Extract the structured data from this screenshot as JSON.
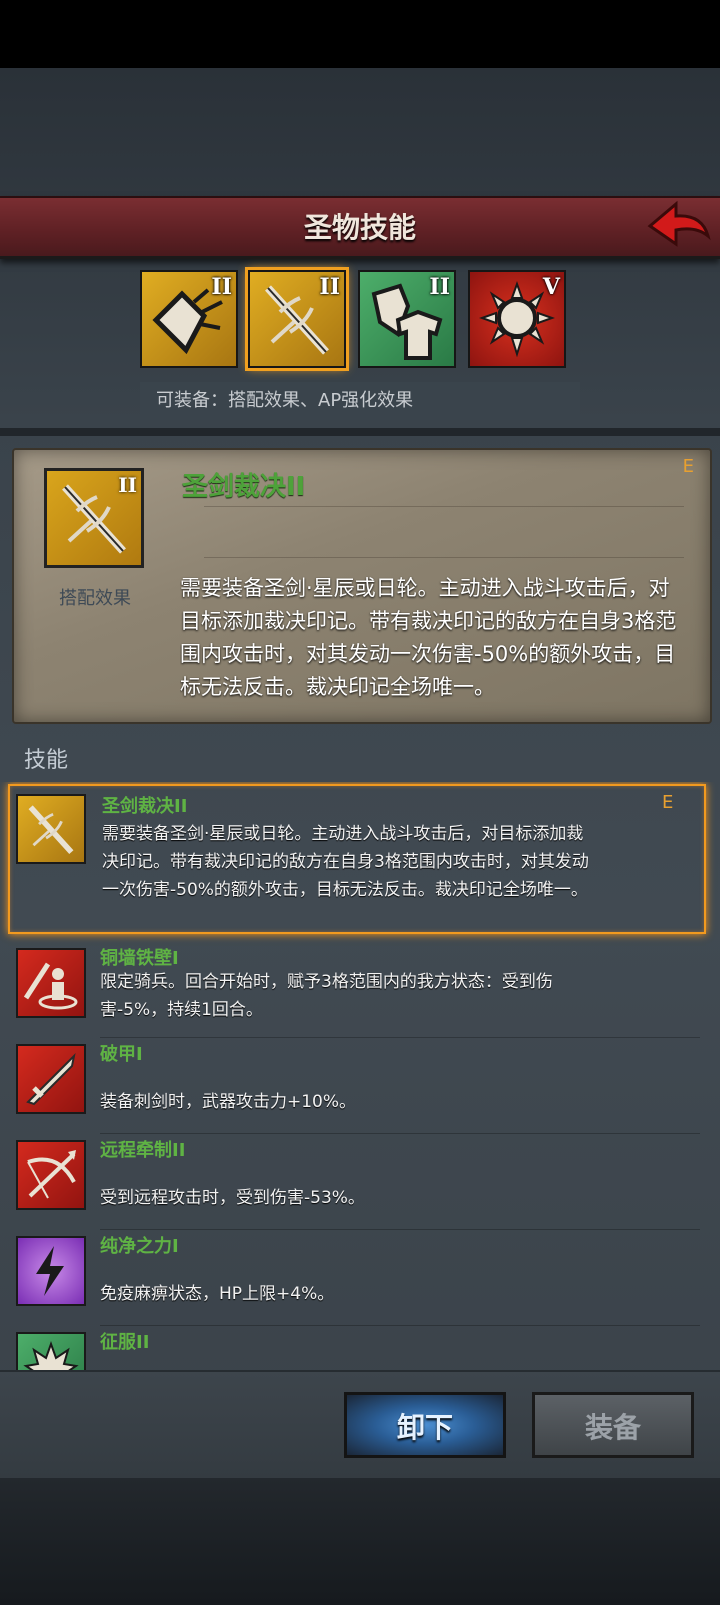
{
  "header": {
    "title": "圣物技能"
  },
  "relics": [
    {
      "level": "II",
      "icon": "shield-strike-icon",
      "color": "#d6a21a"
    },
    {
      "level": "II",
      "icon": "holy-sword-icon",
      "color": "#d6a21a",
      "selected": true
    },
    {
      "level": "II",
      "icon": "shield-armor-icon",
      "color": "#3e9a58"
    },
    {
      "level": "V",
      "icon": "sun-emblem-icon",
      "color": "#c0201a"
    }
  ],
  "equip_hint": "可装备：搭配效果、AP强化效果",
  "detail": {
    "icon_level": "II",
    "sub_label": "搭配效果",
    "name": "圣剑裁决II",
    "rank": "E",
    "description": "需要装备圣剑·星辰或日轮。主动进入战斗攻击后，对目标添加裁决印记。带有裁决印记的敌方在自身3格范围内攻击时，对其发动一次伤害-50%的额外攻击，目标无法反击。裁决印记全场唯一。"
  },
  "skills_header": "技能",
  "skills": [
    {
      "name": "圣剑裁决II",
      "rank": "E",
      "icon": "holy-sword-icon",
      "color": "#d6a21a",
      "desc": "需要装备圣剑·星辰或日轮。主动进入战斗攻击后，对目标添加裁决印记。带有裁决印记的敌方在自身3格范围内攻击时，对其发动一次伤害-50%的额外攻击，目标无法反击。裁决印记全场唯一。"
    },
    {
      "name": "铜墙铁壁I",
      "rank": "",
      "icon": "knight-aura-icon",
      "color": "#c0201a",
      "desc": "限定骑兵。回合开始时，赋予3格范围内的我方状态：受到伤害-5%，持续1回合。"
    },
    {
      "name": "破甲I",
      "rank": "",
      "icon": "sword-icon",
      "color": "#c0201a",
      "desc": "装备刺剑时，武器攻击力+10%。"
    },
    {
      "name": "远程牵制II",
      "rank": "",
      "icon": "crossbow-icon",
      "color": "#c0201a",
      "desc": "受到远程攻击时，受到伤害-53%。"
    },
    {
      "name": "纯净之力I",
      "rank": "",
      "icon": "lightning-icon",
      "color": "#8a3cc8",
      "desc": "免疫麻痹状态，HP上限+4%。"
    },
    {
      "name": "征服II",
      "rank": "",
      "icon": "burst-icon",
      "color": "#3e9a58",
      "desc": ""
    }
  ],
  "buttons": {
    "unequip": "卸下",
    "equip": "装备"
  }
}
